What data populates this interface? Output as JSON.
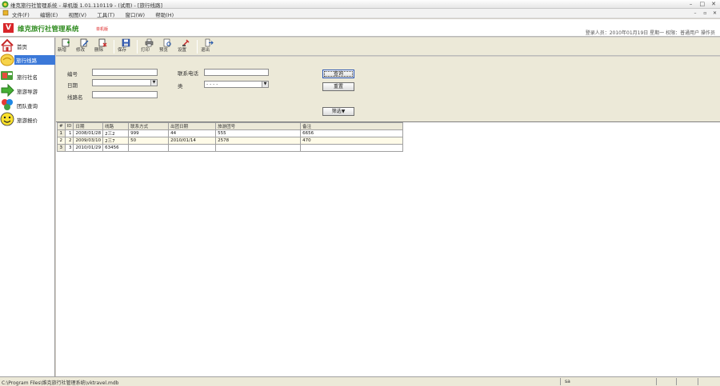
{
  "window": {
    "title": "维克旅行社管理系统 - 单机版 1.01.110119 - (试用) - [旅行线路]",
    "controls": [
      "–",
      "□",
      "✕"
    ]
  },
  "menubar": {
    "items": [
      "文件(F)",
      "编辑(E)",
      "视图(V)",
      "工具(T)",
      "窗口(W)",
      "帮助(H)"
    ],
    "mdi_controls": [
      "–",
      "▫",
      "✕"
    ]
  },
  "header": {
    "logo_text": "V",
    "system_name": "维克旅行社管理系统",
    "edition": "单机版",
    "user_info": "登录人员：2010年01月19日 星期一   权限：普通用户   操作员"
  },
  "toolbar": {
    "buttons": [
      {
        "label": "新增",
        "icon": "add-icon"
      },
      {
        "label": "修改",
        "icon": "edit-icon"
      },
      {
        "label": "删除",
        "icon": "delete-icon"
      },
      {
        "label": "保存",
        "icon": "save-icon"
      },
      {
        "label": "打印",
        "icon": "print-icon"
      },
      {
        "label": "预览",
        "icon": "preview-icon"
      },
      {
        "label": "设置",
        "icon": "settings-icon"
      },
      {
        "label": "退出",
        "icon": "exit-icon"
      }
    ]
  },
  "sidebar": {
    "items": [
      {
        "label": "首页",
        "icon": "home-icon"
      },
      {
        "label": "旅行线路",
        "icon": "route-icon"
      },
      {
        "label": "旅行社名",
        "icon": "agency-icon"
      },
      {
        "label": "旅游导游",
        "icon": "guide-icon"
      },
      {
        "label": "团队查询",
        "icon": "team-icon"
      },
      {
        "label": "旅游报价",
        "icon": "quote-icon"
      }
    ]
  },
  "form": {
    "labels": {
      "field1": "编号",
      "field2": "日期",
      "field3": "线路名",
      "field4": "联系电话",
      "field5": "类"
    },
    "values": {
      "field1": "",
      "field3": "",
      "field4": "",
      "select_date": "",
      "select_type": "- - - -"
    },
    "buttons": {
      "query": "查询",
      "reset": "重置",
      "filter": "筛选▼"
    }
  },
  "grid": {
    "columns": [
      "#",
      "ID",
      "日期",
      "线路",
      "联系方式",
      "出团日期",
      "旅游团号",
      "备注"
    ],
    "rows": [
      [
        "1",
        "1",
        "2008/01/28",
        "2三2",
        "999",
        "44",
        "555",
        "6656"
      ],
      [
        "2",
        "2",
        "2009/03/10",
        "2三7",
        "50",
        "2010/01/14",
        "2578",
        "470"
      ],
      [
        "3",
        "3",
        "2010/01/29",
        "63456",
        "",
        "",
        "",
        ""
      ]
    ]
  },
  "status": {
    "path": "C:\\Program Files\\维克旅行社管理系统\\vktravel.mdb",
    "code": "sa"
  }
}
